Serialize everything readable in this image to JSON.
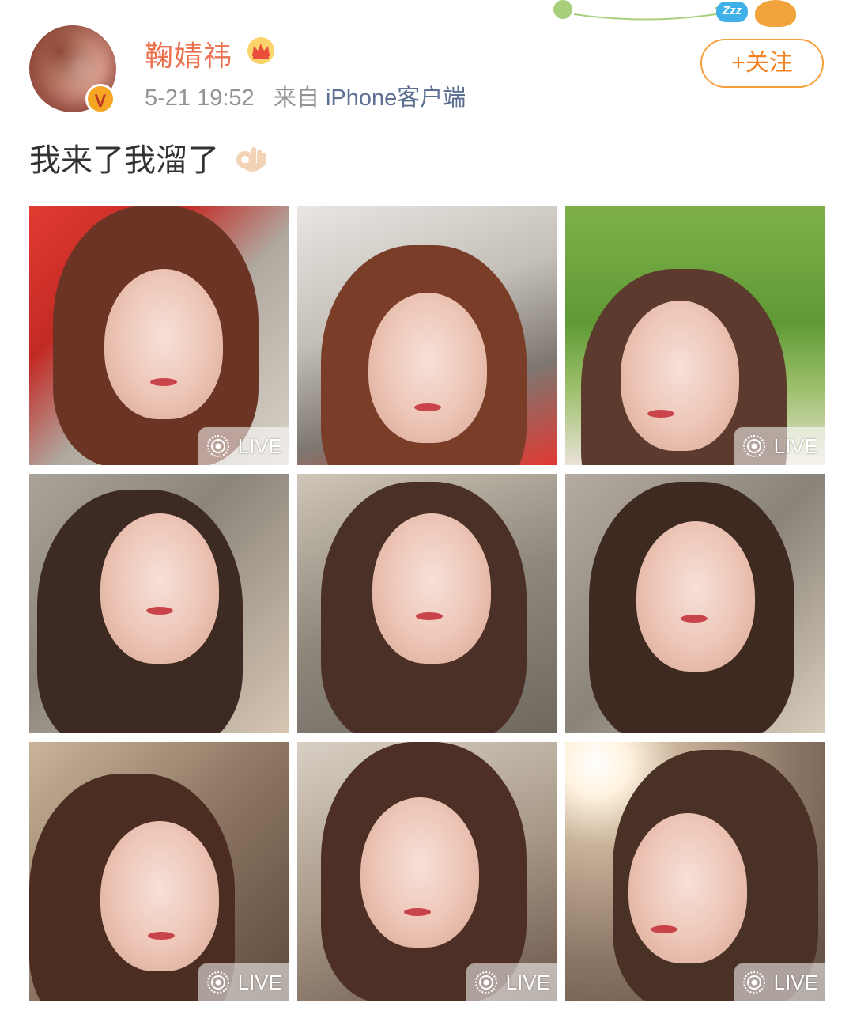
{
  "post": {
    "username": "鞠婧祎",
    "timestamp": "5-21 19:52",
    "source_prefix": "来自",
    "source_client": "iPhone客户端",
    "follow_label": "+关注",
    "text": "我来了我溜了"
  },
  "decor": {
    "zzz_label": "Zzz"
  },
  "icons": {
    "verified": "verified-badge-icon",
    "crown": "crown-icon",
    "emoji": "ok-hand-emoji"
  },
  "colors": {
    "username": "#eb7350",
    "follow_border": "#f5a13e",
    "source_link": "#5d6f93",
    "meta": "#939393"
  },
  "photos": [
    {
      "live": true,
      "live_label": "LIVE"
    },
    {
      "live": false,
      "live_label": ""
    },
    {
      "live": true,
      "live_label": "LIVE"
    },
    {
      "live": false,
      "live_label": ""
    },
    {
      "live": false,
      "live_label": ""
    },
    {
      "live": false,
      "live_label": ""
    },
    {
      "live": true,
      "live_label": "LIVE"
    },
    {
      "live": true,
      "live_label": "LIVE"
    },
    {
      "live": true,
      "live_label": "LIVE"
    }
  ]
}
